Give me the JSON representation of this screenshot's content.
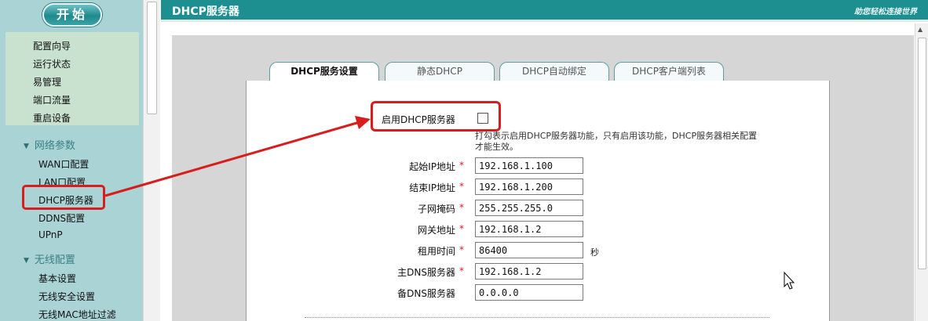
{
  "sidebar": {
    "start_label": "开始",
    "quick_items": [
      "配置向导",
      "运行状态",
      "易管理",
      "端口流量",
      "重启设备"
    ],
    "network_section": "网络参数",
    "network_items": [
      "WAN口配置",
      "LAN口配置",
      "DHCP服务器",
      "DDNS配置",
      "UPnP"
    ],
    "wireless_section": "无线配置",
    "wireless_items": [
      "基本设置",
      "无线安全设置",
      "无线MAC地址过滤"
    ]
  },
  "header": {
    "title": "DHCP服务器",
    "brand": "助您轻松连接世界"
  },
  "tabs": [
    "DHCP服务设置",
    "静态DHCP",
    "DHCP自动绑定",
    "DHCP客户端列表"
  ],
  "dhcp": {
    "enable_label": "启用DHCP服务器",
    "enable_checked": false,
    "hint": "打勾表示启用DHCP服务器功能，只有启用该功能，DHCP服务器相关配置才能生效。",
    "required_mark": "*",
    "fields": [
      {
        "label": "起始IP地址",
        "value": "192.168.1.100",
        "required": true
      },
      {
        "label": "结束IP地址",
        "value": "192.168.1.200",
        "required": true
      },
      {
        "label": "子网掩码",
        "value": "255.255.255.0",
        "required": true
      },
      {
        "label": "网关地址",
        "value": "192.168.1.2",
        "required": true
      },
      {
        "label": "租用时间",
        "value": "86400",
        "required": true
      },
      {
        "label": "主DNS服务器",
        "value": "192.168.1.2",
        "required": true
      },
      {
        "label": "备DNS服务器",
        "value": "0.0.0.0",
        "required": false
      }
    ],
    "lease_unit": "秒"
  },
  "colors": {
    "header": "#1d8f91",
    "sidebar": "#a9d3d5",
    "highlight": "#d91c1c"
  }
}
